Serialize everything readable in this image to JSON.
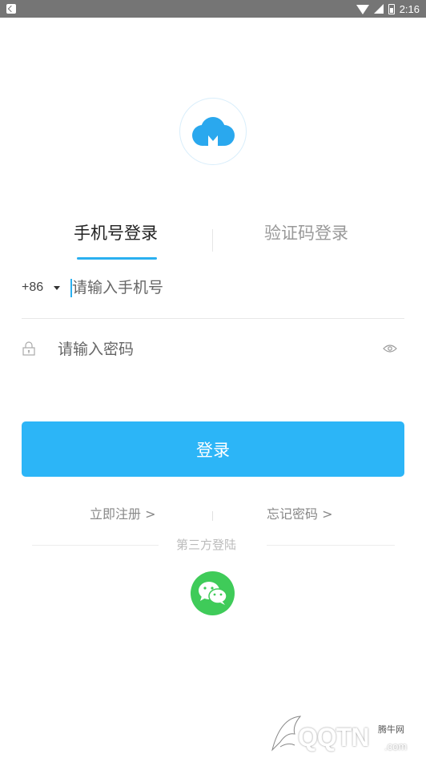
{
  "status_bar": {
    "time": "2:16"
  },
  "tabs": [
    {
      "label": "手机号登录",
      "active": true
    },
    {
      "label": "验证码登录",
      "active": false
    }
  ],
  "phone": {
    "country_code": "+86",
    "placeholder": "请输入手机号",
    "value": ""
  },
  "password": {
    "placeholder": "请输入密码",
    "value": ""
  },
  "login_button": "登录",
  "links": {
    "register": "立即注册 >",
    "forgot": "忘记密码 >"
  },
  "third_party": {
    "label": "第三方登陆",
    "icon": "wechat-icon"
  },
  "watermark": {
    "brand": "QQTN",
    "sub": "腾牛网",
    "domain": ".com"
  },
  "colors": {
    "accent": "#2cb5f7",
    "wechat": "#3fcb59"
  }
}
